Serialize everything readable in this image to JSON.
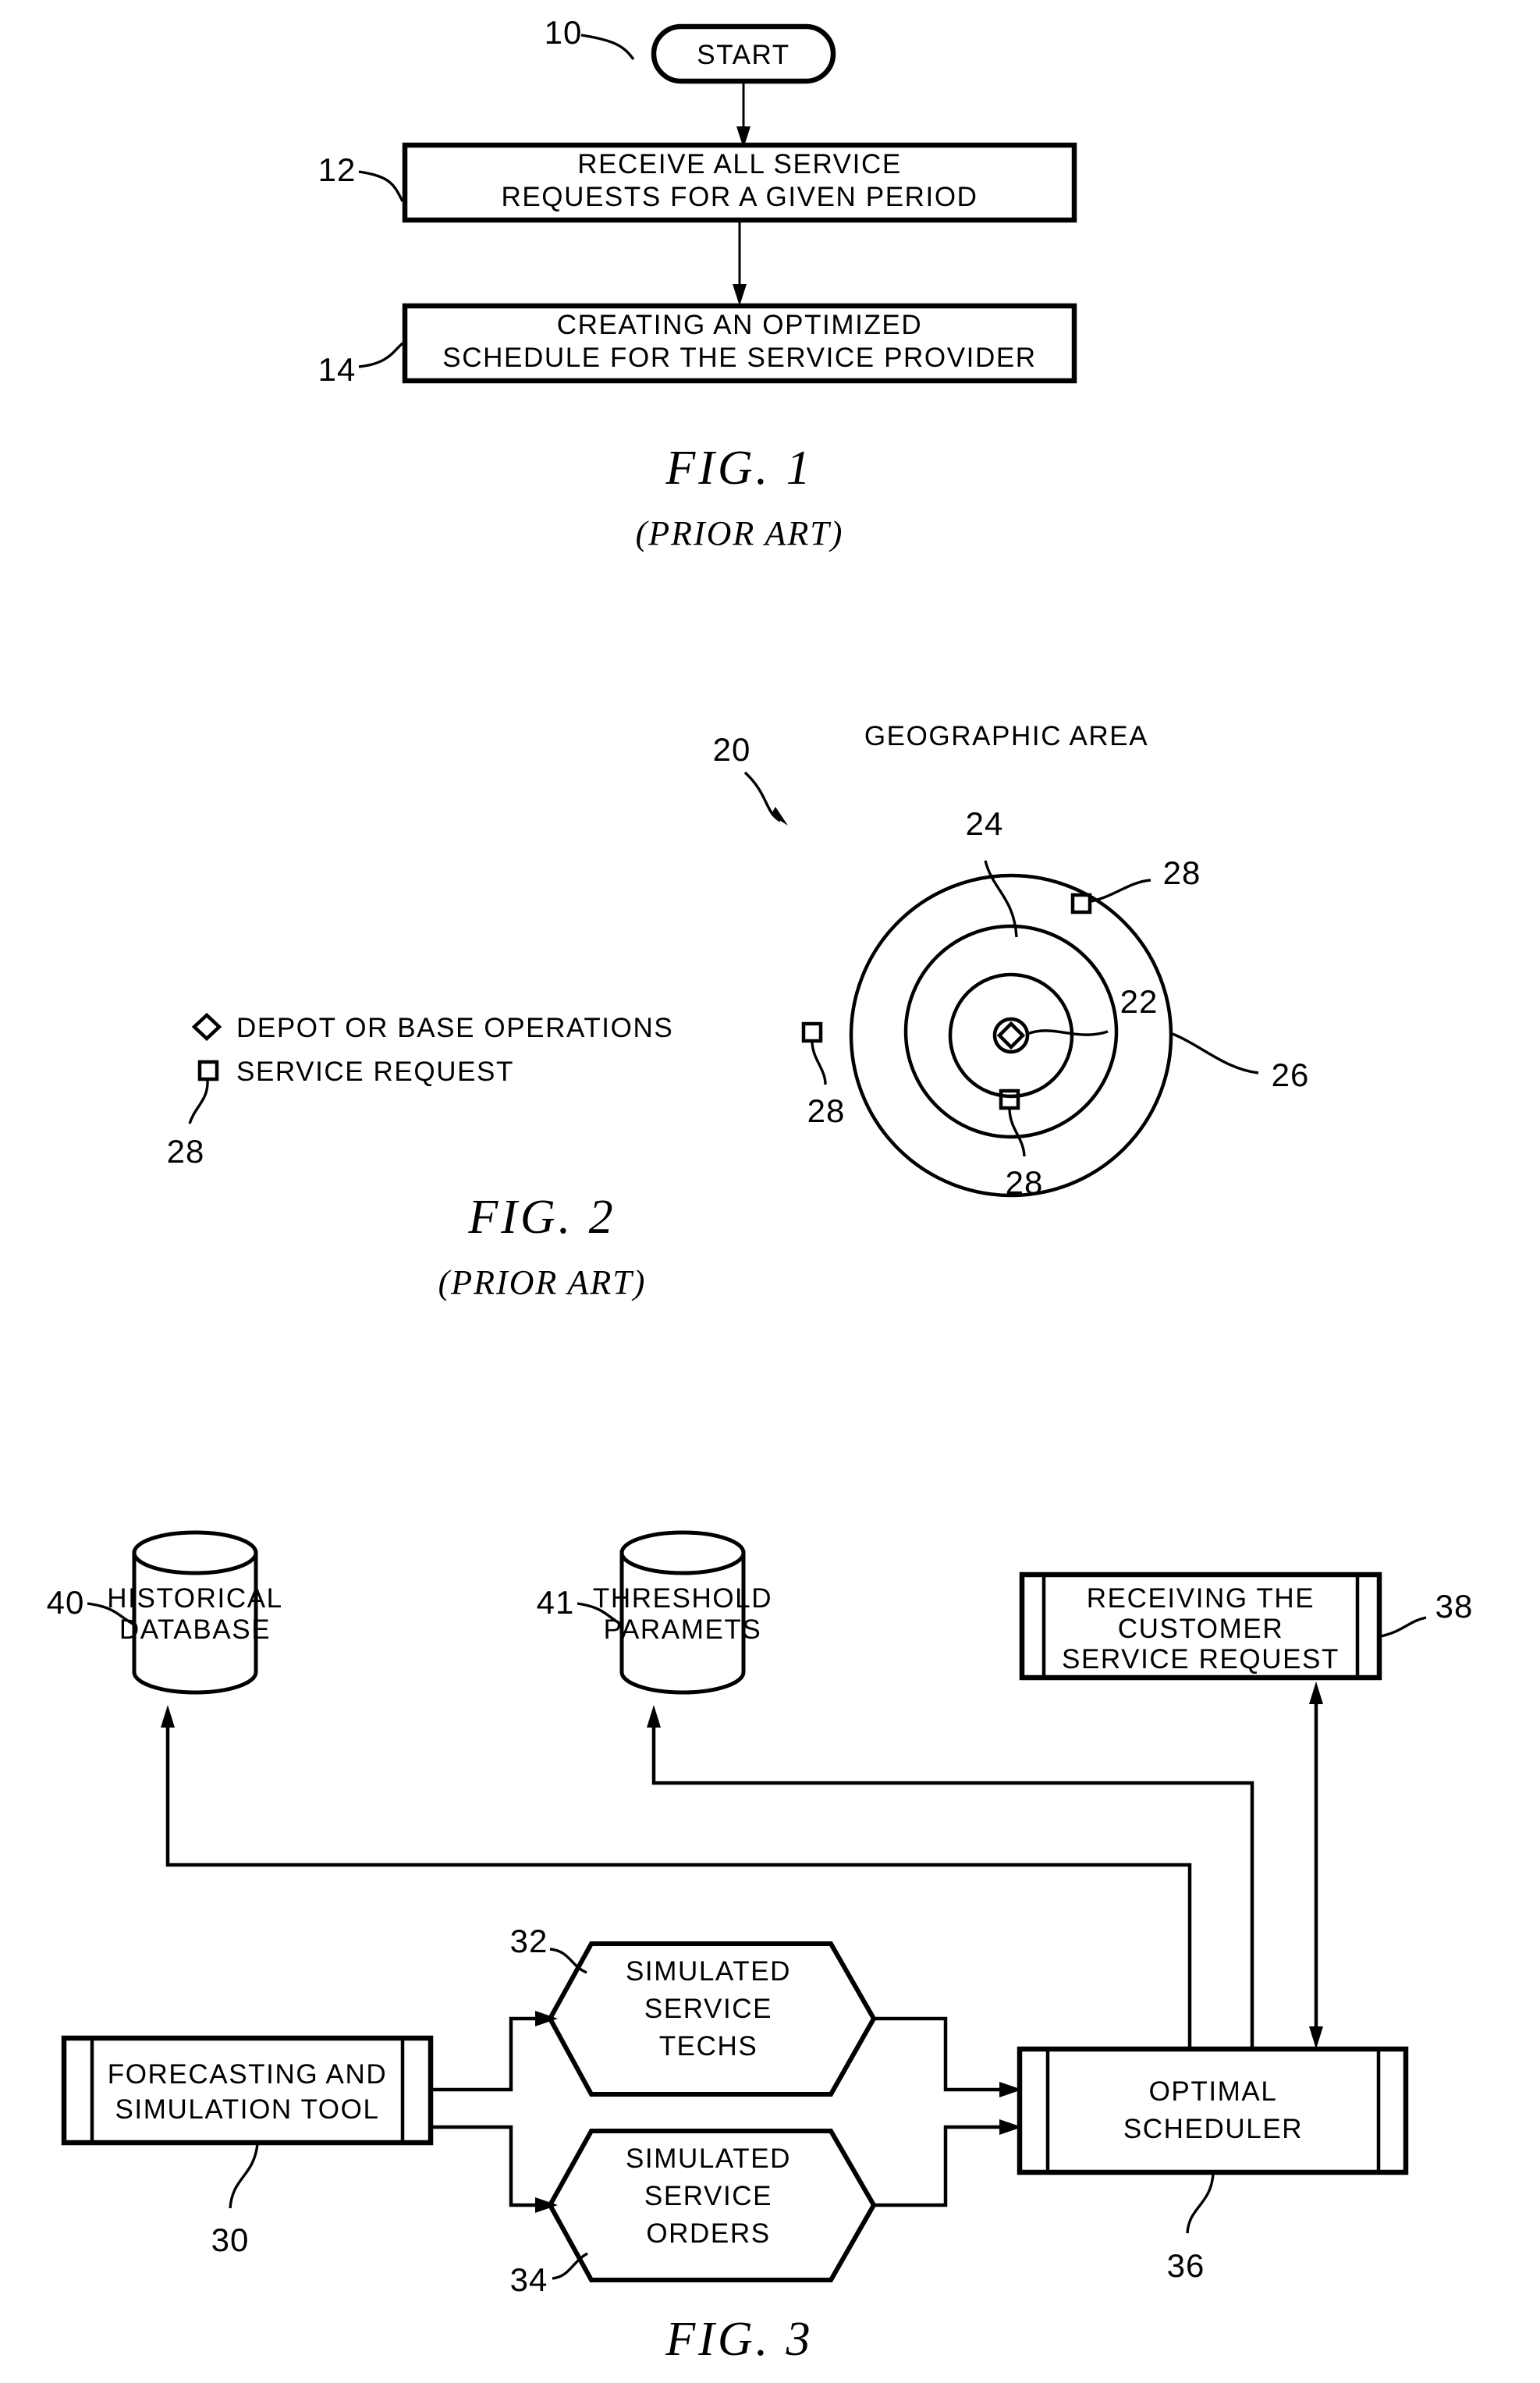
{
  "figures": [
    {
      "id": "fig1",
      "caption": "FIG.  1",
      "subcaption": "(PRIOR ART)",
      "nodes": [
        {
          "ref": "10",
          "label": "START",
          "shape": "terminator"
        },
        {
          "ref": "12",
          "label_line1": "RECEIVE ALL SERVICE",
          "label_line2": "REQUESTS FOR A GIVEN PERIOD",
          "shape": "process"
        },
        {
          "ref": "14",
          "label_line1": "CREATING AN OPTIMIZED",
          "label_line2": "SCHEDULE FOR THE SERVICE PROVIDER",
          "shape": "process"
        }
      ]
    },
    {
      "id": "fig2",
      "caption": "FIG.  2",
      "subcaption": "(PRIOR ART)",
      "title": "GEOGRAPHIC AREA",
      "diagram_ref": "20",
      "legend": [
        {
          "symbol": "diamond",
          "text": "DEPOT OR BASE OPERATIONS"
        },
        {
          "symbol": "square",
          "text": "SERVICE REQUEST"
        }
      ],
      "legend_ref": "28",
      "rings": [
        {
          "ref": "22",
          "name": "depot-marker"
        },
        {
          "ref": "24",
          "name": "inner-ring"
        },
        {
          "ref": "26",
          "name": "outer-ring"
        }
      ],
      "request_refs": [
        "28",
        "28",
        "28"
      ]
    },
    {
      "id": "fig3",
      "caption": "FIG.  3",
      "nodes": [
        {
          "ref": "40",
          "shape": "cylinder",
          "label_line1": "HISTORICAL",
          "label_line2": "DATABASE"
        },
        {
          "ref": "41",
          "shape": "cylinder",
          "label_line1": "THRESHOLD",
          "label_line2": "PARAMETS"
        },
        {
          "ref": "38",
          "shape": "predefined-process",
          "label_line1": "RECEIVING THE",
          "label_line2": "CUSTOMER",
          "label_line3": "SERVICE REQUEST"
        },
        {
          "ref": "30",
          "shape": "predefined-process",
          "label_line1": "FORECASTING AND",
          "label_line2": "SIMULATION TOOL"
        },
        {
          "ref": "32",
          "shape": "hexagon",
          "label_line1": "SIMULATED",
          "label_line2": "SERVICE",
          "label_line3": "TECHS"
        },
        {
          "ref": "34",
          "shape": "hexagon",
          "label_line1": "SIMULATED",
          "label_line2": "SERVICE",
          "label_line3": "ORDERS"
        },
        {
          "ref": "36",
          "shape": "predefined-process",
          "label_line1": "OPTIMAL",
          "label_line2": "SCHEDULER"
        }
      ]
    }
  ],
  "colors": {
    "ink": "#000000",
    "paper": "#ffffff"
  }
}
